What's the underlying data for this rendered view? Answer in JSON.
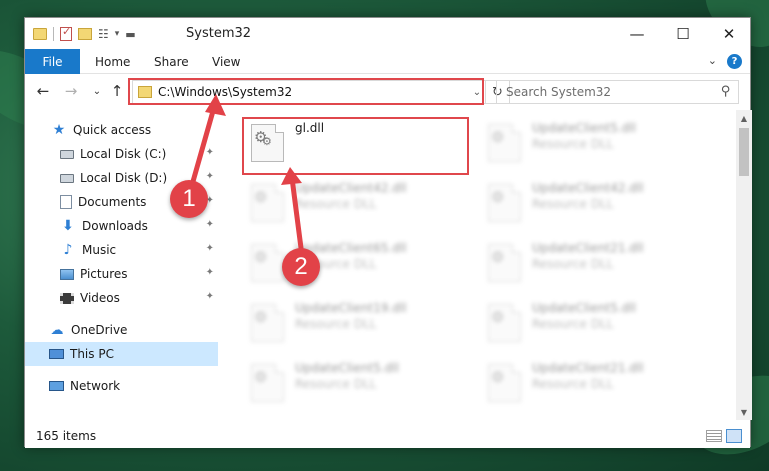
{
  "window": {
    "title": "System32",
    "minimize_glyph": "—",
    "maximize_glyph": "☐",
    "close_glyph": "✕"
  },
  "ribbon": {
    "file": "File",
    "home": "Home",
    "share": "Share",
    "view": "View"
  },
  "address_bar": {
    "path": "C:\\Windows\\System32",
    "search_placeholder": "Search System32"
  },
  "nav_pane": {
    "quick_access": "Quick access",
    "items": [
      {
        "label": "Local Disk (C:)",
        "icon": "drive-icon",
        "pinned": true
      },
      {
        "label": "Local Disk (D:)",
        "icon": "drive-icon",
        "pinned": true
      },
      {
        "label": "Documents",
        "icon": "documents-icon",
        "pinned": true
      },
      {
        "label": "Downloads",
        "icon": "downloads-icon",
        "pinned": true
      },
      {
        "label": "Music",
        "icon": "music-icon",
        "pinned": true
      },
      {
        "label": "Pictures",
        "icon": "pictures-icon",
        "pinned": true
      },
      {
        "label": "Videos",
        "icon": "videos-icon",
        "pinned": true
      }
    ],
    "onedrive": "OneDrive",
    "this_pc": "This PC",
    "network": "Network"
  },
  "files": [
    {
      "name": "gl.dll",
      "type": ""
    },
    {
      "name": "UpdateClient5.dll",
      "type": "Resource DLL"
    },
    {
      "name": "UpdateClient42.dll",
      "type": "Resource DLL"
    },
    {
      "name": "UpdateClient42.dll",
      "type": "Resource DLL"
    },
    {
      "name": "UpdateClient65.dll",
      "type": "Resource DLL"
    },
    {
      "name": "UpdateClient21.dll",
      "type": "Resource DLL"
    },
    {
      "name": "UpdateClient19.dll",
      "type": "Resource DLL"
    },
    {
      "name": "UpdateClient5.dll",
      "type": "Resource DLL"
    },
    {
      "name": "UpdateClient5.dll",
      "type": "Resource DLL"
    },
    {
      "name": "UpdateClient21.dll",
      "type": "Resource DLL"
    }
  ],
  "status": {
    "item_count": "165 items"
  },
  "annotations": {
    "marker_1": "1",
    "marker_2": "2",
    "color": "#e24248"
  },
  "colors": {
    "accent": "#1979ca",
    "selected_bg": "#cce8ff"
  }
}
